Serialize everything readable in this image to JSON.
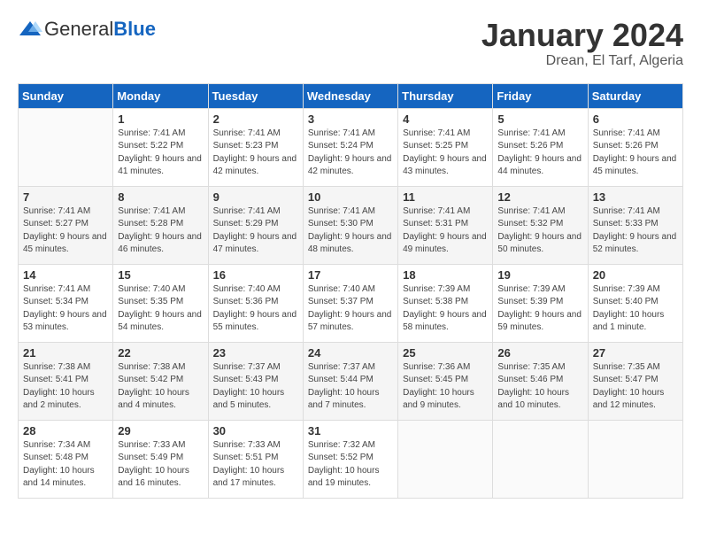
{
  "header": {
    "logo_general": "General",
    "logo_blue": "Blue",
    "month_title": "January 2024",
    "subtitle": "Drean, El Tarf, Algeria"
  },
  "weekdays": [
    "Sunday",
    "Monday",
    "Tuesday",
    "Wednesday",
    "Thursday",
    "Friday",
    "Saturday"
  ],
  "weeks": [
    {
      "shaded": false,
      "days": [
        {
          "num": "",
          "empty": true
        },
        {
          "num": "1",
          "sunrise": "7:41 AM",
          "sunset": "5:22 PM",
          "daylight": "9 hours and 41 minutes."
        },
        {
          "num": "2",
          "sunrise": "7:41 AM",
          "sunset": "5:23 PM",
          "daylight": "9 hours and 42 minutes."
        },
        {
          "num": "3",
          "sunrise": "7:41 AM",
          "sunset": "5:24 PM",
          "daylight": "9 hours and 42 minutes."
        },
        {
          "num": "4",
          "sunrise": "7:41 AM",
          "sunset": "5:25 PM",
          "daylight": "9 hours and 43 minutes."
        },
        {
          "num": "5",
          "sunrise": "7:41 AM",
          "sunset": "5:26 PM",
          "daylight": "9 hours and 44 minutes."
        },
        {
          "num": "6",
          "sunrise": "7:41 AM",
          "sunset": "5:26 PM",
          "daylight": "9 hours and 45 minutes."
        }
      ]
    },
    {
      "shaded": true,
      "days": [
        {
          "num": "7",
          "sunrise": "7:41 AM",
          "sunset": "5:27 PM",
          "daylight": "9 hours and 45 minutes."
        },
        {
          "num": "8",
          "sunrise": "7:41 AM",
          "sunset": "5:28 PM",
          "daylight": "9 hours and 46 minutes."
        },
        {
          "num": "9",
          "sunrise": "7:41 AM",
          "sunset": "5:29 PM",
          "daylight": "9 hours and 47 minutes."
        },
        {
          "num": "10",
          "sunrise": "7:41 AM",
          "sunset": "5:30 PM",
          "daylight": "9 hours and 48 minutes."
        },
        {
          "num": "11",
          "sunrise": "7:41 AM",
          "sunset": "5:31 PM",
          "daylight": "9 hours and 49 minutes."
        },
        {
          "num": "12",
          "sunrise": "7:41 AM",
          "sunset": "5:32 PM",
          "daylight": "9 hours and 50 minutes."
        },
        {
          "num": "13",
          "sunrise": "7:41 AM",
          "sunset": "5:33 PM",
          "daylight": "9 hours and 52 minutes."
        }
      ]
    },
    {
      "shaded": false,
      "days": [
        {
          "num": "14",
          "sunrise": "7:41 AM",
          "sunset": "5:34 PM",
          "daylight": "9 hours and 53 minutes."
        },
        {
          "num": "15",
          "sunrise": "7:40 AM",
          "sunset": "5:35 PM",
          "daylight": "9 hours and 54 minutes."
        },
        {
          "num": "16",
          "sunrise": "7:40 AM",
          "sunset": "5:36 PM",
          "daylight": "9 hours and 55 minutes."
        },
        {
          "num": "17",
          "sunrise": "7:40 AM",
          "sunset": "5:37 PM",
          "daylight": "9 hours and 57 minutes."
        },
        {
          "num": "18",
          "sunrise": "7:39 AM",
          "sunset": "5:38 PM",
          "daylight": "9 hours and 58 minutes."
        },
        {
          "num": "19",
          "sunrise": "7:39 AM",
          "sunset": "5:39 PM",
          "daylight": "9 hours and 59 minutes."
        },
        {
          "num": "20",
          "sunrise": "7:39 AM",
          "sunset": "5:40 PM",
          "daylight": "10 hours and 1 minute."
        }
      ]
    },
    {
      "shaded": true,
      "days": [
        {
          "num": "21",
          "sunrise": "7:38 AM",
          "sunset": "5:41 PM",
          "daylight": "10 hours and 2 minutes."
        },
        {
          "num": "22",
          "sunrise": "7:38 AM",
          "sunset": "5:42 PM",
          "daylight": "10 hours and 4 minutes."
        },
        {
          "num": "23",
          "sunrise": "7:37 AM",
          "sunset": "5:43 PM",
          "daylight": "10 hours and 5 minutes."
        },
        {
          "num": "24",
          "sunrise": "7:37 AM",
          "sunset": "5:44 PM",
          "daylight": "10 hours and 7 minutes."
        },
        {
          "num": "25",
          "sunrise": "7:36 AM",
          "sunset": "5:45 PM",
          "daylight": "10 hours and 9 minutes."
        },
        {
          "num": "26",
          "sunrise": "7:35 AM",
          "sunset": "5:46 PM",
          "daylight": "10 hours and 10 minutes."
        },
        {
          "num": "27",
          "sunrise": "7:35 AM",
          "sunset": "5:47 PM",
          "daylight": "10 hours and 12 minutes."
        }
      ]
    },
    {
      "shaded": false,
      "days": [
        {
          "num": "28",
          "sunrise": "7:34 AM",
          "sunset": "5:48 PM",
          "daylight": "10 hours and 14 minutes."
        },
        {
          "num": "29",
          "sunrise": "7:33 AM",
          "sunset": "5:49 PM",
          "daylight": "10 hours and 16 minutes."
        },
        {
          "num": "30",
          "sunrise": "7:33 AM",
          "sunset": "5:51 PM",
          "daylight": "10 hours and 17 minutes."
        },
        {
          "num": "31",
          "sunrise": "7:32 AM",
          "sunset": "5:52 PM",
          "daylight": "10 hours and 19 minutes."
        },
        {
          "num": "",
          "empty": true
        },
        {
          "num": "",
          "empty": true
        },
        {
          "num": "",
          "empty": true
        }
      ]
    }
  ]
}
